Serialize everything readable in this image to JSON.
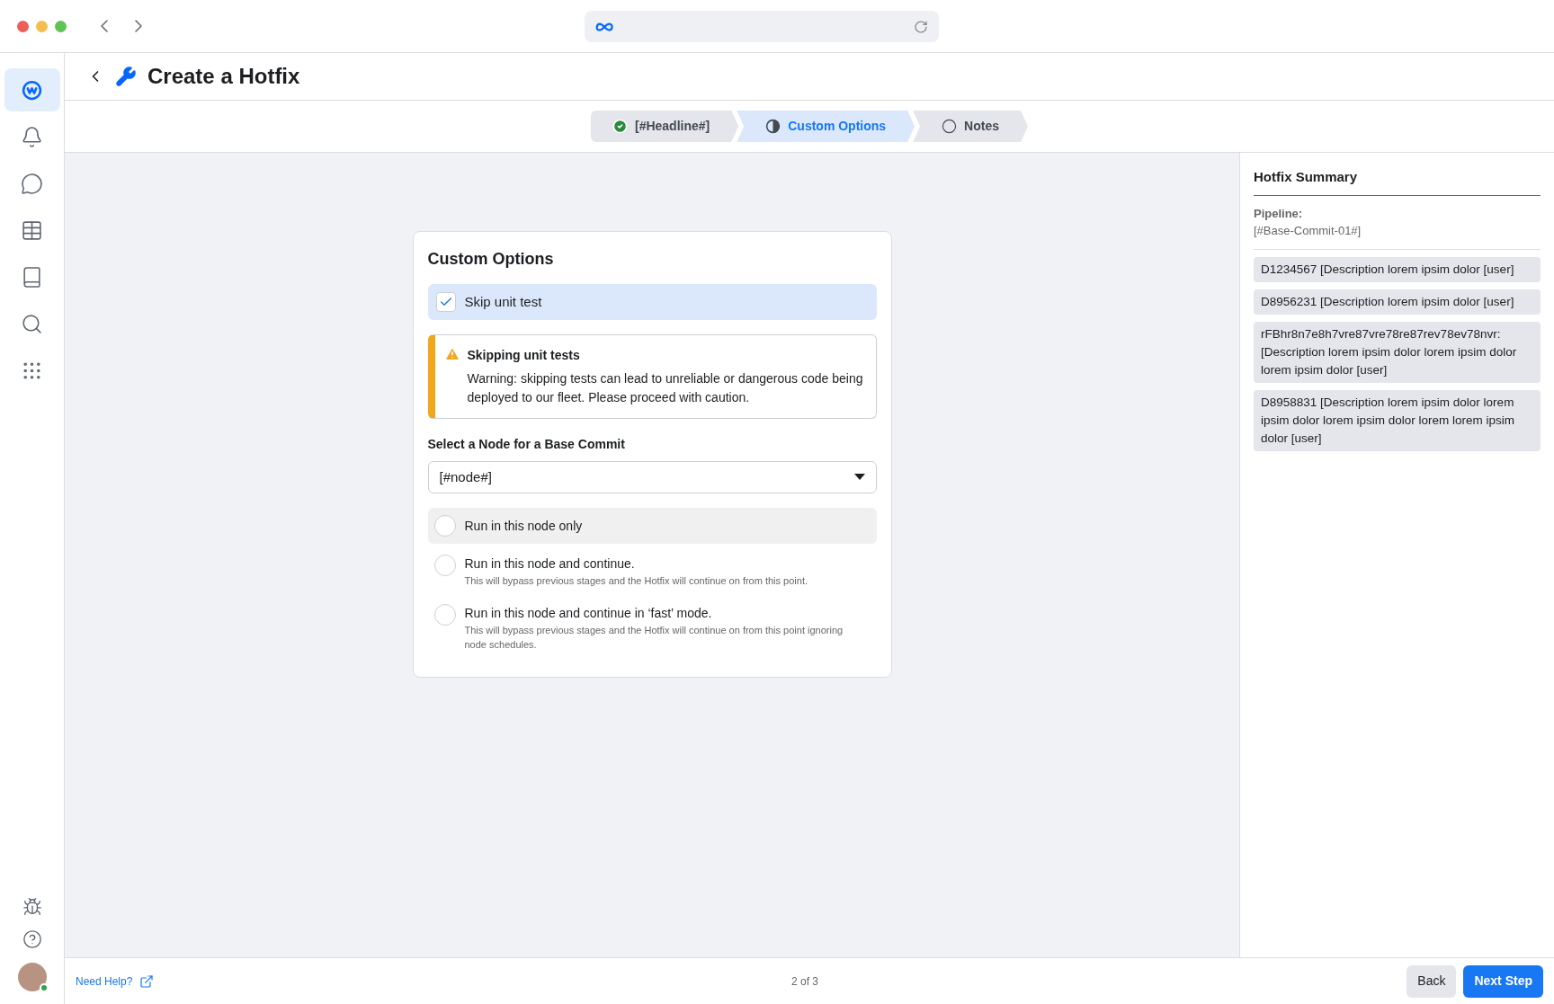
{
  "page": {
    "title": "Create a Hotfix"
  },
  "sidebar": {
    "items": [
      {
        "kind": "workplace",
        "selected": true
      },
      {
        "kind": "bell",
        "selected": false
      },
      {
        "kind": "chat",
        "selected": false
      },
      {
        "kind": "table",
        "selected": false
      },
      {
        "kind": "book",
        "selected": false
      },
      {
        "kind": "search",
        "selected": false
      },
      {
        "kind": "apps",
        "selected": false
      }
    ],
    "bottom_items": [
      {
        "kind": "bug"
      },
      {
        "kind": "help"
      }
    ],
    "avatar": {
      "online": true
    }
  },
  "stepper": [
    {
      "label": "[#Headline#]",
      "kind": "complete",
      "selected": false
    },
    {
      "label": "Custom Options",
      "kind": "current",
      "selected": true
    },
    {
      "label": "Notes",
      "kind": "pending",
      "selected": false
    }
  ],
  "card": {
    "title": "Custom Options",
    "checkbox": {
      "label": "Skip unit test",
      "checked": true
    },
    "warning": {
      "title": "Skipping unit tests",
      "text": "Warning: skipping tests can lead to unreliable or dangerous code being deployed to our fleet. Please proceed with caution."
    },
    "select": {
      "label": "Select a Node for a Base Commit",
      "value": "[#node#]"
    },
    "radios": [
      {
        "label": "Run in this node only",
        "selected": false,
        "hovered": true
      },
      {
        "label": "Run in this node and continue.",
        "description": "This will bypass previous stages and the Hotfix will continue on from this point.",
        "selected": false,
        "hovered": false
      },
      {
        "label": "Run in this node and continue in ‘fast’ mode.",
        "description": "This will bypass previous stages and the Hotfix will continue on from this point ignoring node schedules.",
        "selected": false,
        "hovered": false
      }
    ]
  },
  "summary": {
    "title": "Hotfix Summary",
    "pipeline_label": "Pipeline:",
    "pipeline_value": "[#Base-Commit-01#]",
    "items": [
      "D1234567 [Description lorem ipsim dolor [user]",
      "D8956231 [Description lorem ipsim dolor [user]",
      "rFBhr8n7e8h7vre87vre78re87rev78ev78nvr: [Description lorem ipsim dolor lorem ipsim dolor lorem ipsim dolor [user]",
      "D8958831 [Description lorem ipsim dolor lorem ipsim dolor lorem ipsim dolor lorem lorem ipsim dolor [user]"
    ]
  },
  "footer": {
    "help_link": "Need Help?",
    "page_count": "2 of 3",
    "buttons": [
      {
        "label": "Back",
        "kind": "secondary"
      },
      {
        "label": "Next Step",
        "kind": "primary"
      }
    ]
  }
}
